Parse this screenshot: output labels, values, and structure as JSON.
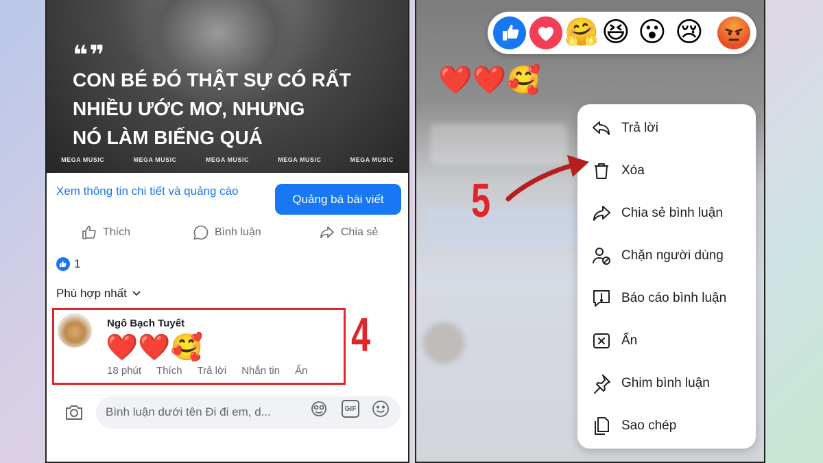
{
  "colors": {
    "brand": "#1877f2",
    "annotation": "#e0262b",
    "text": "#1c1e21",
    "muted": "#65676b"
  },
  "left": {
    "post_image": {
      "quote_mark": "❝❞",
      "quote_lines": [
        "CON BÉ ĐÓ THẬT SỰ CÓ RẤT",
        "NHIỀU ƯỚC MƠ, NHƯNG",
        "NÓ LÀM BIẾNG QUÁ"
      ],
      "watermarks": [
        "MEGA MUSIC",
        "MEGA MUSIC",
        "MEGA MUSIC",
        "MEGA MUSIC",
        "MEGA MUSIC"
      ]
    },
    "promo": {
      "link_text": "Xem thông tin chi tiết và quảng cáo",
      "button_label": "Quảng bá bài viết"
    },
    "actions": {
      "like": "Thích",
      "comment": "Bình luận",
      "share": "Chia sẻ"
    },
    "like_count": "1",
    "sort_label": "Phù hợp nhất",
    "comment": {
      "author": "Ngô Bạch Tuyết",
      "content": "❤️❤️🥰",
      "time": "18 phút",
      "like": "Thích",
      "reply": "Trả lời",
      "message": "Nhắn tin",
      "hide": "Ẩn"
    },
    "step_label": "4",
    "composer": {
      "placeholder": "Bình luận dưới tên Đi đi em, d...",
      "gif": "GIF"
    }
  },
  "right": {
    "reactions": [
      "like-icon",
      "love-icon",
      "care-icon",
      "haha-icon",
      "wow-icon",
      "sad-icon",
      "angry-icon"
    ],
    "comment_preview": "❤️❤️🥰",
    "step_label": "5",
    "menu": [
      {
        "icon": "reply-icon",
        "label": "Trả lời"
      },
      {
        "icon": "trash-icon",
        "label": "Xóa"
      },
      {
        "icon": "share-icon",
        "label": "Chia sẻ bình luận"
      },
      {
        "icon": "block-user-icon",
        "label": "Chặn người dùng"
      },
      {
        "icon": "report-icon",
        "label": "Báo cáo bình luận"
      },
      {
        "icon": "hide-icon",
        "label": "Ẩn"
      },
      {
        "icon": "pin-icon",
        "label": "Ghim bình luận"
      },
      {
        "icon": "copy-icon",
        "label": "Sao chép"
      }
    ]
  }
}
